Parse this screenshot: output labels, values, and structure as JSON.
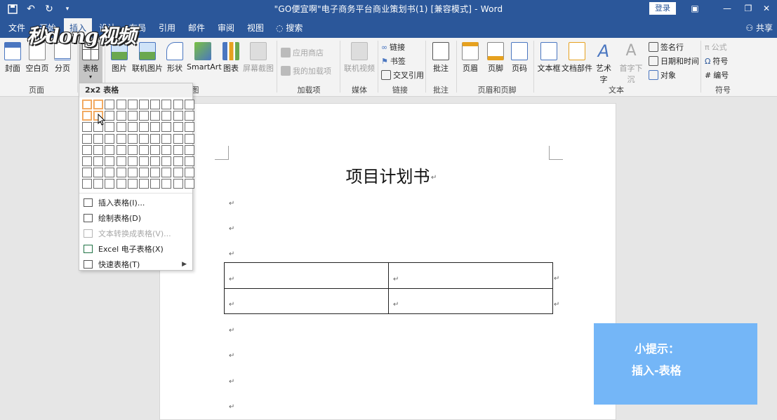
{
  "window": {
    "title": "\"GO便宜啊\"电子商务平台商业策划书(1) [兼容模式] - Word",
    "login": "登录"
  },
  "tabs": [
    {
      "label": "文件"
    },
    {
      "label": "开始"
    },
    {
      "label": "插入"
    },
    {
      "label": "设计"
    },
    {
      "label": "布局"
    },
    {
      "label": "引用"
    },
    {
      "label": "邮件"
    },
    {
      "label": "审阅"
    },
    {
      "label": "视图"
    }
  ],
  "search": "搜索",
  "share": "共享",
  "logo": "秒dong视频",
  "ribbon": {
    "pages": {
      "cover": "封面",
      "blank": "空白页",
      "break": "分页",
      "label": "页面"
    },
    "tables": {
      "table": "表格"
    },
    "illustrations": {
      "pictures": "图片",
      "online_pictures": "联机图片",
      "shapes": "形状",
      "smartart": "SmartArt",
      "chart": "图表",
      "screenshot": "屏幕截图",
      "label": "图"
    },
    "addins": {
      "store": "应用商店",
      "my_addins": "我的加载项",
      "label": "加载项"
    },
    "media": {
      "online_video": "联机视频",
      "label": "媒体"
    },
    "links": {
      "link": "链接",
      "bookmark": "书签",
      "cross_ref": "交叉引用",
      "label": "链接"
    },
    "comments": {
      "comment": "批注",
      "label": "批注"
    },
    "header_footer": {
      "header": "页眉",
      "footer": "页脚",
      "page_number": "页码",
      "label": "页眉和页脚"
    },
    "text": {
      "text_box": "文本框",
      "quick_parts": "文档部件",
      "wordart": "艺术字",
      "drop_cap": "首字下沉",
      "signature": "签名行",
      "date_time": "日期和时间",
      "object": "对象",
      "label": "文本"
    },
    "symbols": {
      "equation": "公式",
      "symbol": "符号",
      "number": "编号",
      "label": "符号"
    }
  },
  "table_dropdown": {
    "header": "2x2 表格",
    "grid_rows": 8,
    "grid_cols": 10,
    "selected_rows": 2,
    "selected_cols": 2,
    "items": [
      {
        "label": "插入表格(I)...",
        "enabled": true
      },
      {
        "label": "绘制表格(D)",
        "enabled": true
      },
      {
        "label": "文本转换成表格(V)...",
        "enabled": false
      },
      {
        "label": "Excel 电子表格(X)",
        "enabled": true
      },
      {
        "label": "快速表格(T)",
        "enabled": true
      }
    ]
  },
  "document": {
    "title": "项目计划书",
    "paragraph_mark": "↵"
  },
  "tip": {
    "line1": "小提示：",
    "line2": "插入-表格"
  },
  "colors": {
    "word_blue": "#2b579a",
    "tip_bg": "#74b6f7",
    "grid_highlight": "#f0a050"
  }
}
